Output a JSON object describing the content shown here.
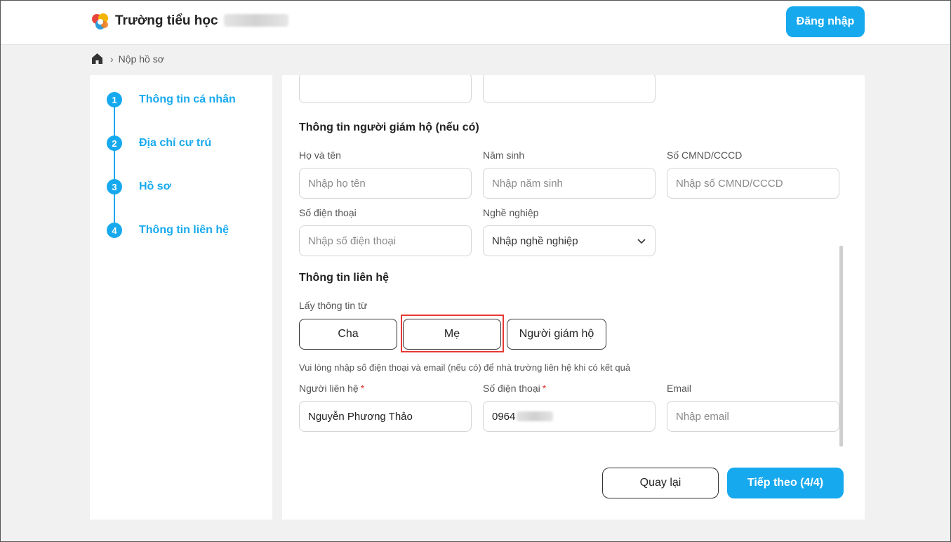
{
  "header": {
    "school_name": "Trường tiểu học",
    "login_label": "Đăng nhập"
  },
  "breadcrumb": {
    "current": "Nộp hồ sơ"
  },
  "steps": [
    {
      "number": "1",
      "label": "Thông tin cá nhân"
    },
    {
      "number": "2",
      "label": "Địa chỉ cư trú"
    },
    {
      "number": "3",
      "label": "Hồ sơ"
    },
    {
      "number": "4",
      "label": "Thông tin liên hệ"
    }
  ],
  "guardian": {
    "title": "Thông tin người giám hộ (nếu có)",
    "name_label": "Họ và tên",
    "name_placeholder": "Nhập họ tên",
    "birth_label": "Năm sinh",
    "birth_placeholder": "Nhập năm sinh",
    "id_label": "Số CMND/CCCD",
    "id_placeholder": "Nhập số CMND/CCCD",
    "phone_label": "Số điện thoại",
    "phone_placeholder": "Nhập số điện thoại",
    "job_label": "Nghề nghiệp",
    "job_value": "Nhập nghề nghiệp"
  },
  "contact": {
    "title": "Thông tin liên hệ",
    "source_label": "Lấy thông tin từ",
    "source_options": [
      "Cha",
      "Mẹ",
      "Người giám hộ"
    ],
    "hint": "Vui lòng nhập số điện thoại và email (nếu có) để nhà trường liên hệ khi có kết quả",
    "person_label": "Người liên hệ",
    "person_value": "Nguyễn Phương Thảo",
    "phone_label": "Số điện thoại",
    "phone_value": "0964",
    "email_label": "Email",
    "email_placeholder": "Nhập email",
    "required_mark": "*"
  },
  "actions": {
    "back_label": "Quay lại",
    "next_label": "Tiếp theo (4/4)"
  },
  "colors": {
    "accent": "#17a9ee",
    "highlight": "#e53935"
  }
}
